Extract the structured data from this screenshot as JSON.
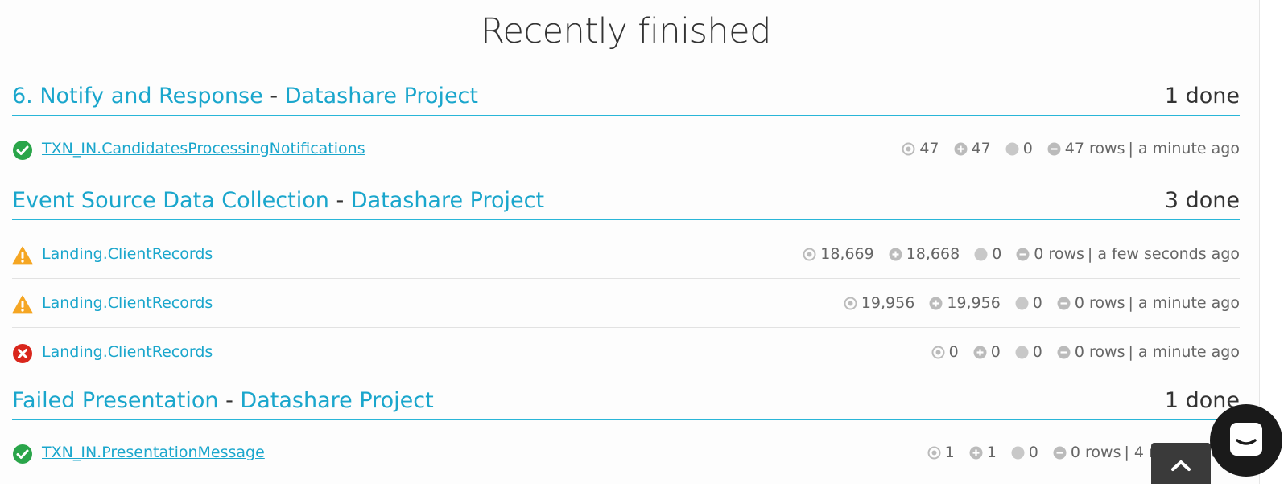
{
  "heading": "Recently finished",
  "groups": [
    {
      "title": "6. Notify and Response",
      "separator": "-",
      "project": "Datashare Project",
      "count": "1 done",
      "rows": [
        {
          "status": "success",
          "name": "TXN_IN.CandidatesProcessingNotifications",
          "read": "47",
          "inserted": "47",
          "updated": "0",
          "rows": "47 rows",
          "time": "| a minute ago"
        }
      ]
    },
    {
      "title": "Event Source Data Collection",
      "separator": "-",
      "project": "Datashare Project",
      "count": "3 done",
      "rows": [
        {
          "status": "warning",
          "name": "Landing.ClientRecords",
          "read": "18,669",
          "inserted": "18,668",
          "updated": "0",
          "rows": "0 rows",
          "time": "| a few seconds ago"
        },
        {
          "status": "warning",
          "name": "Landing.ClientRecords",
          "read": "19,956",
          "inserted": "19,956",
          "updated": "0",
          "rows": "0 rows",
          "time": "| a minute ago"
        },
        {
          "status": "error",
          "name": "Landing.ClientRecords",
          "read": "0",
          "inserted": "0",
          "updated": "0",
          "rows": "0 rows",
          "time": "| a minute ago"
        }
      ]
    },
    {
      "title": "Failed Presentation",
      "separator": "-",
      "project": "Datashare Project",
      "count": "1 done",
      "rows": [
        {
          "status": "success",
          "name": "TXN_IN.PresentationMessage",
          "read": "1",
          "inserted": "1",
          "updated": "0",
          "rows": "0 rows",
          "time": "| 4 months ago"
        }
      ]
    }
  ],
  "icons": {
    "success": "check-circle-icon",
    "warning": "warning-triangle-icon",
    "error": "error-circle-icon",
    "read": "target-icon",
    "inserted": "plus-circle-icon",
    "updated": "dot-circle-icon",
    "deleted": "minus-circle-icon",
    "chat": "chat-icon",
    "scroll_top": "chevron-up-icon"
  },
  "colors": {
    "link": "#1aa6cc",
    "accent_line": "#29b6d8",
    "success": "#2aa54a",
    "warning": "#f5a623",
    "error": "#d9261c"
  }
}
